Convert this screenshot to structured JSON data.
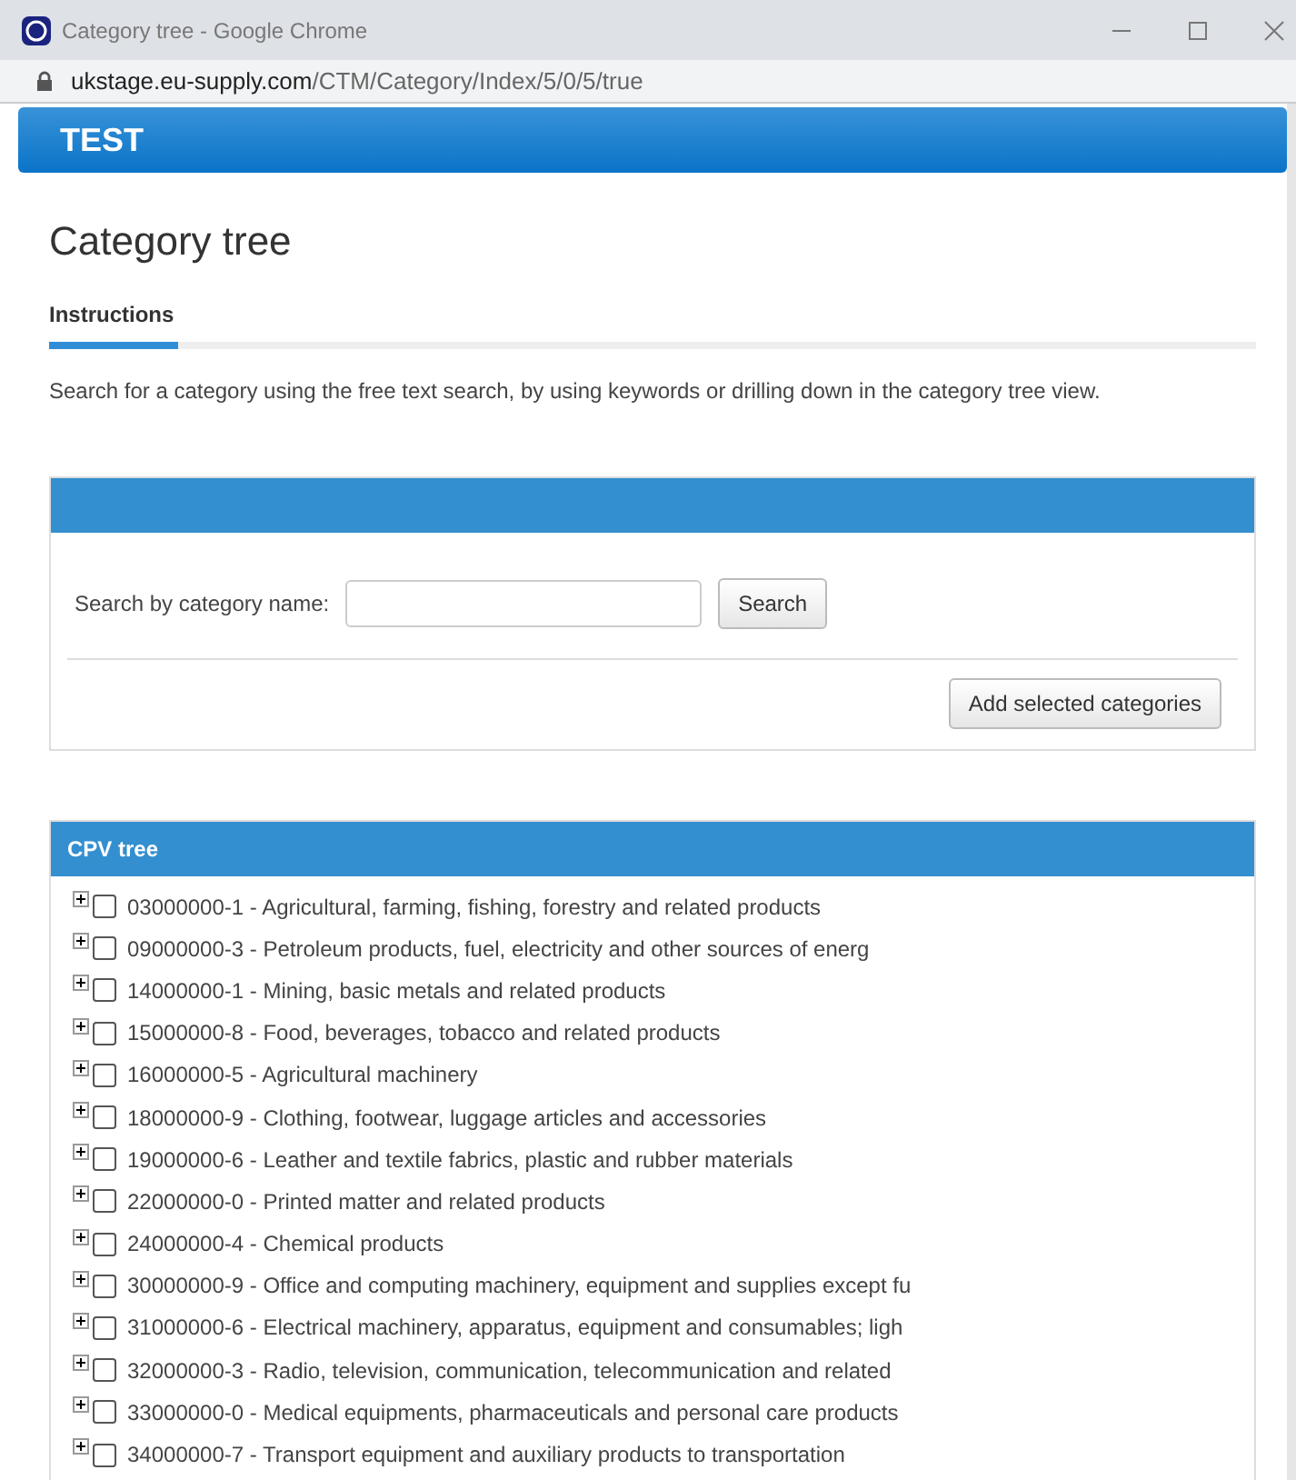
{
  "window": {
    "title": "Category tree - Google Chrome",
    "url_host": "ukstage.eu-supply.com",
    "url_path": "/CTM/Category/Index/5/0/5/true"
  },
  "banner": {
    "title": "TEST"
  },
  "page_title": "Category tree",
  "tabs": [
    {
      "label": "Instructions",
      "selected": true
    }
  ],
  "instructions": "Search for a category using the free text search, by using keywords or drilling down in the category tree view.",
  "search_panel": {
    "label": "Search by category name:",
    "search_button": "Search",
    "add_button": "Add selected categories"
  },
  "tree_panel": {
    "title": "CPV tree",
    "items": [
      {
        "label": "03000000-1 - Agricultural, farming, fishing, forestry and related products",
        "expanded": false,
        "checked": false
      },
      {
        "label": "09000000-3 - Petroleum products, fuel, electricity and other sources of energ",
        "expanded": false,
        "checked": false
      },
      {
        "label": "14000000-1 - Mining, basic metals and related products",
        "expanded": false,
        "checked": false
      },
      {
        "label": "15000000-8 - Food, beverages, tobacco and related products",
        "expanded": false,
        "checked": false
      },
      {
        "label": "16000000-5 - Agricultural machinery",
        "expanded": false,
        "checked": false
      },
      {
        "label": "18000000-9 - Clothing, footwear, luggage articles and accessories",
        "expanded": false,
        "checked": false
      },
      {
        "label": "19000000-6 - Leather and textile fabrics, plastic and rubber materials",
        "expanded": false,
        "checked": false
      },
      {
        "label": "22000000-0 - Printed matter and related products",
        "expanded": false,
        "checked": false
      },
      {
        "label": "24000000-4 - Chemical products",
        "expanded": false,
        "checked": false
      },
      {
        "label": "30000000-9 - Office and computing machinery, equipment and supplies except fu",
        "expanded": false,
        "checked": false
      },
      {
        "label": "31000000-6 - Electrical machinery, apparatus, equipment and consumables; ligh",
        "expanded": false,
        "checked": false
      },
      {
        "label": "32000000-3 - Radio, television, communication, telecommunication and related",
        "expanded": false,
        "checked": false
      },
      {
        "label": "33000000-0 - Medical equipments, pharmaceuticals and personal care products",
        "expanded": false,
        "checked": false
      },
      {
        "label": "34000000-7 - Transport equipment and auxiliary products to transportation",
        "expanded": false,
        "checked": false
      }
    ]
  }
}
